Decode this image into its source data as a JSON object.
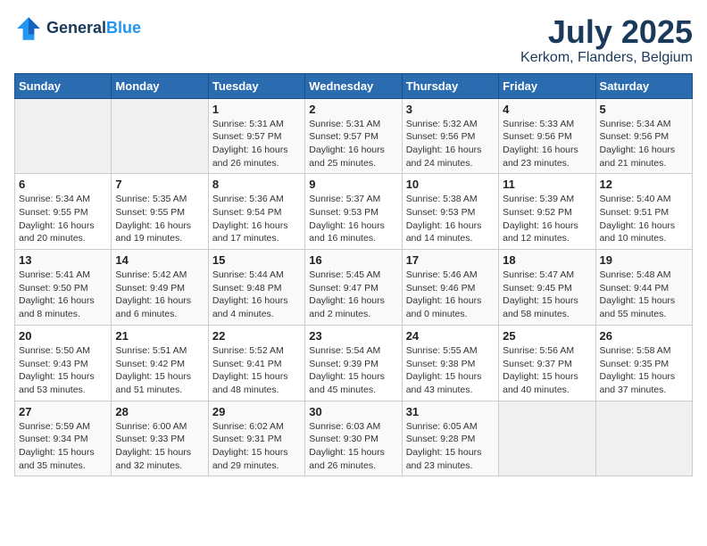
{
  "header": {
    "logo_line1": "General",
    "logo_line2": "Blue",
    "month_year": "July 2025",
    "location": "Kerkom, Flanders, Belgium"
  },
  "days_of_week": [
    "Sunday",
    "Monday",
    "Tuesday",
    "Wednesday",
    "Thursday",
    "Friday",
    "Saturday"
  ],
  "weeks": [
    [
      {
        "day": "",
        "detail": ""
      },
      {
        "day": "",
        "detail": ""
      },
      {
        "day": "1",
        "detail": "Sunrise: 5:31 AM\nSunset: 9:57 PM\nDaylight: 16 hours\nand 26 minutes."
      },
      {
        "day": "2",
        "detail": "Sunrise: 5:31 AM\nSunset: 9:57 PM\nDaylight: 16 hours\nand 25 minutes."
      },
      {
        "day": "3",
        "detail": "Sunrise: 5:32 AM\nSunset: 9:56 PM\nDaylight: 16 hours\nand 24 minutes."
      },
      {
        "day": "4",
        "detail": "Sunrise: 5:33 AM\nSunset: 9:56 PM\nDaylight: 16 hours\nand 23 minutes."
      },
      {
        "day": "5",
        "detail": "Sunrise: 5:34 AM\nSunset: 9:56 PM\nDaylight: 16 hours\nand 21 minutes."
      }
    ],
    [
      {
        "day": "6",
        "detail": "Sunrise: 5:34 AM\nSunset: 9:55 PM\nDaylight: 16 hours\nand 20 minutes."
      },
      {
        "day": "7",
        "detail": "Sunrise: 5:35 AM\nSunset: 9:55 PM\nDaylight: 16 hours\nand 19 minutes."
      },
      {
        "day": "8",
        "detail": "Sunrise: 5:36 AM\nSunset: 9:54 PM\nDaylight: 16 hours\nand 17 minutes."
      },
      {
        "day": "9",
        "detail": "Sunrise: 5:37 AM\nSunset: 9:53 PM\nDaylight: 16 hours\nand 16 minutes."
      },
      {
        "day": "10",
        "detail": "Sunrise: 5:38 AM\nSunset: 9:53 PM\nDaylight: 16 hours\nand 14 minutes."
      },
      {
        "day": "11",
        "detail": "Sunrise: 5:39 AM\nSunset: 9:52 PM\nDaylight: 16 hours\nand 12 minutes."
      },
      {
        "day": "12",
        "detail": "Sunrise: 5:40 AM\nSunset: 9:51 PM\nDaylight: 16 hours\nand 10 minutes."
      }
    ],
    [
      {
        "day": "13",
        "detail": "Sunrise: 5:41 AM\nSunset: 9:50 PM\nDaylight: 16 hours\nand 8 minutes."
      },
      {
        "day": "14",
        "detail": "Sunrise: 5:42 AM\nSunset: 9:49 PM\nDaylight: 16 hours\nand 6 minutes."
      },
      {
        "day": "15",
        "detail": "Sunrise: 5:44 AM\nSunset: 9:48 PM\nDaylight: 16 hours\nand 4 minutes."
      },
      {
        "day": "16",
        "detail": "Sunrise: 5:45 AM\nSunset: 9:47 PM\nDaylight: 16 hours\nand 2 minutes."
      },
      {
        "day": "17",
        "detail": "Sunrise: 5:46 AM\nSunset: 9:46 PM\nDaylight: 16 hours\nand 0 minutes."
      },
      {
        "day": "18",
        "detail": "Sunrise: 5:47 AM\nSunset: 9:45 PM\nDaylight: 15 hours\nand 58 minutes."
      },
      {
        "day": "19",
        "detail": "Sunrise: 5:48 AM\nSunset: 9:44 PM\nDaylight: 15 hours\nand 55 minutes."
      }
    ],
    [
      {
        "day": "20",
        "detail": "Sunrise: 5:50 AM\nSunset: 9:43 PM\nDaylight: 15 hours\nand 53 minutes."
      },
      {
        "day": "21",
        "detail": "Sunrise: 5:51 AM\nSunset: 9:42 PM\nDaylight: 15 hours\nand 51 minutes."
      },
      {
        "day": "22",
        "detail": "Sunrise: 5:52 AM\nSunset: 9:41 PM\nDaylight: 15 hours\nand 48 minutes."
      },
      {
        "day": "23",
        "detail": "Sunrise: 5:54 AM\nSunset: 9:39 PM\nDaylight: 15 hours\nand 45 minutes."
      },
      {
        "day": "24",
        "detail": "Sunrise: 5:55 AM\nSunset: 9:38 PM\nDaylight: 15 hours\nand 43 minutes."
      },
      {
        "day": "25",
        "detail": "Sunrise: 5:56 AM\nSunset: 9:37 PM\nDaylight: 15 hours\nand 40 minutes."
      },
      {
        "day": "26",
        "detail": "Sunrise: 5:58 AM\nSunset: 9:35 PM\nDaylight: 15 hours\nand 37 minutes."
      }
    ],
    [
      {
        "day": "27",
        "detail": "Sunrise: 5:59 AM\nSunset: 9:34 PM\nDaylight: 15 hours\nand 35 minutes."
      },
      {
        "day": "28",
        "detail": "Sunrise: 6:00 AM\nSunset: 9:33 PM\nDaylight: 15 hours\nand 32 minutes."
      },
      {
        "day": "29",
        "detail": "Sunrise: 6:02 AM\nSunset: 9:31 PM\nDaylight: 15 hours\nand 29 minutes."
      },
      {
        "day": "30",
        "detail": "Sunrise: 6:03 AM\nSunset: 9:30 PM\nDaylight: 15 hours\nand 26 minutes."
      },
      {
        "day": "31",
        "detail": "Sunrise: 6:05 AM\nSunset: 9:28 PM\nDaylight: 15 hours\nand 23 minutes."
      },
      {
        "day": "",
        "detail": ""
      },
      {
        "day": "",
        "detail": ""
      }
    ]
  ]
}
